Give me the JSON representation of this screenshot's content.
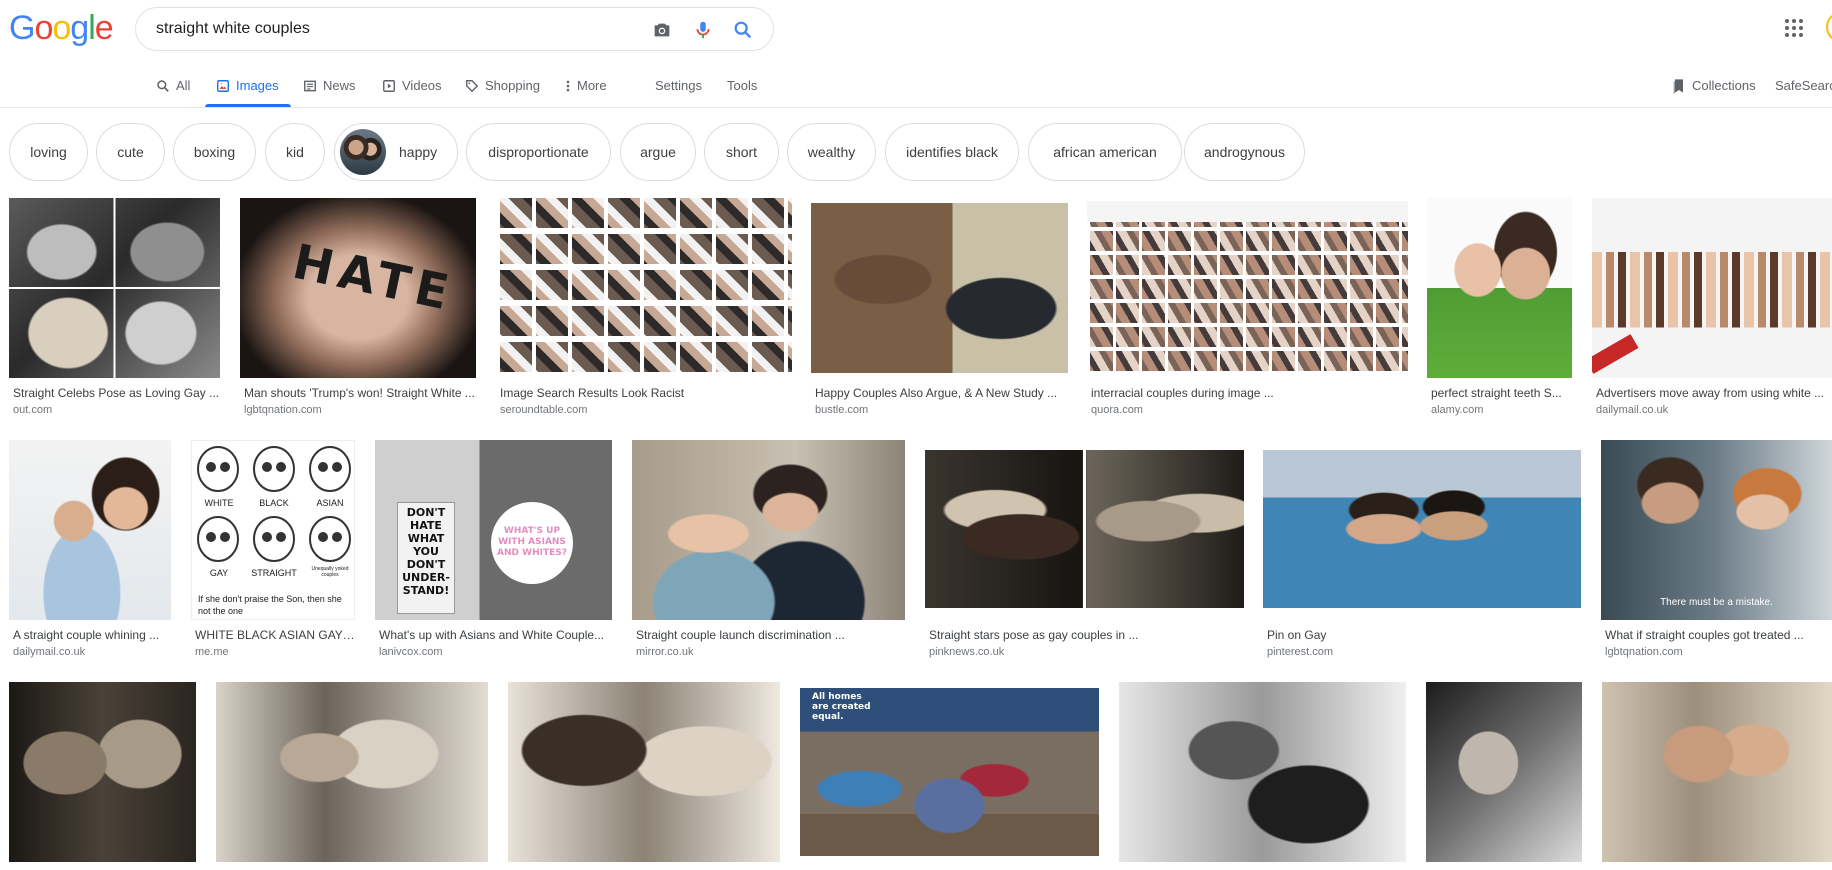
{
  "logo": {
    "letters": [
      "G",
      "o",
      "o",
      "g",
      "l",
      "e"
    ],
    "colors": [
      "#4285f4",
      "#ea4335",
      "#fbbc05",
      "#4285f4",
      "#34a853",
      "#ea4335"
    ]
  },
  "search": {
    "query": "straight white couples"
  },
  "tabs": [
    {
      "label": "All",
      "icon": "search-icon"
    },
    {
      "label": "Images",
      "icon": "image-icon",
      "active": true
    },
    {
      "label": "News",
      "icon": "news-icon"
    },
    {
      "label": "Videos",
      "icon": "play-icon"
    },
    {
      "label": "Shopping",
      "icon": "tag-icon"
    },
    {
      "label": "More",
      "icon": "more-vert-icon"
    }
  ],
  "tools": {
    "settings": "Settings",
    "tools": "Tools"
  },
  "right_nav": {
    "collections": "Collections",
    "safesearch": "SafeSearc"
  },
  "chips": [
    "loving",
    "cute",
    "boxing",
    "kid",
    "happy",
    "disproportionate",
    "argue",
    "short",
    "wealthy",
    "identifies black",
    "african american",
    "androgynous"
  ],
  "rows": [
    [
      {
        "caption": "Straight Celebs Pose as Loving Gay ...",
        "source": "out.com"
      },
      {
        "caption": "Man shouts 'Trump's won! Straight White ...",
        "source": "lgbtqnation.com",
        "image_text": "HATE"
      },
      {
        "caption": "Image Search Results Look Racist",
        "source": "seroundtable.com"
      },
      {
        "caption": "Happy Couples Also Argue, & A New Study ...",
        "source": "bustle.com"
      },
      {
        "caption": "interracial couples during image ...",
        "source": "quora.com"
      },
      {
        "caption": "perfect straight teeth S...",
        "source": "alamy.com"
      },
      {
        "caption": "Advertisers move away from using white ...",
        "source": "dailymail.co.uk"
      }
    ],
    [
      {
        "caption": "A straight couple whining ...",
        "source": "dailymail.co.uk"
      },
      {
        "caption": "WHITE BLACK ASIAN GAY ...",
        "source": "me.me",
        "image_text": [
          "WHITE",
          "BLACK",
          "ASIAN",
          "GAY",
          "STRAIGHT",
          "Unequally yoked couples",
          "If she don't praise the Son, then she not the one"
        ]
      },
      {
        "caption": "What's up with Asians and White Couple...",
        "source": "lanivcox.com",
        "image_text": [
          "DON'T HATE WHAT YOU DON'T UNDER-STAND!",
          "WHAT'S UP WITH ASIANS AND WHITES?"
        ]
      },
      {
        "caption": "Straight couple launch discrimination ...",
        "source": "mirror.co.uk"
      },
      {
        "caption": "Straight stars pose as gay couples in ...",
        "source": "pinknews.co.uk"
      },
      {
        "caption": "Pin on Gay",
        "source": "pinterest.com"
      },
      {
        "caption": "What if straight couples got treated ...",
        "source": "lgbtqnation.com",
        "image_text": "There must be a mistake."
      }
    ],
    [
      {
        "caption": "",
        "source": ""
      },
      {
        "caption": "",
        "source": ""
      },
      {
        "caption": "",
        "source": ""
      },
      {
        "caption": "",
        "source": "",
        "image_text": "All homes are created equal."
      },
      {
        "caption": "",
        "source": ""
      },
      {
        "caption": "",
        "source": ""
      },
      {
        "caption": "",
        "source": ""
      }
    ]
  ]
}
